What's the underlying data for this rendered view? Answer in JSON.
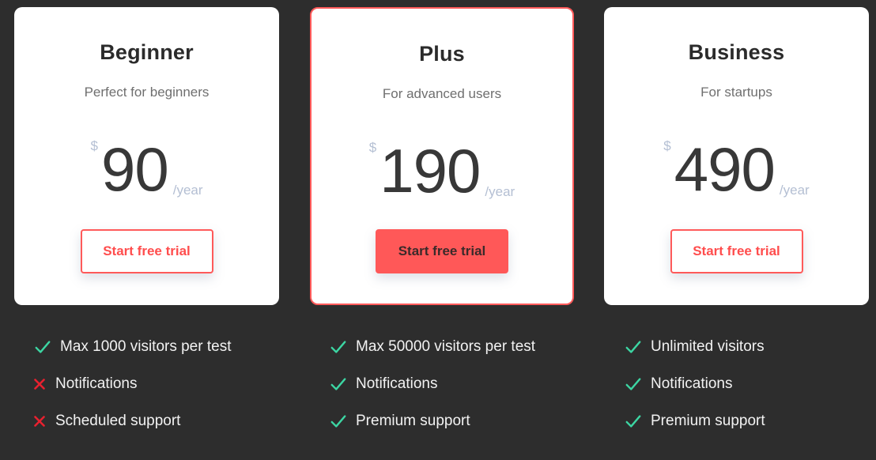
{
  "colors": {
    "background": "#2d2d2d",
    "card": "#ffffff",
    "accent": "#ff5a5a",
    "check": "#3cd6a3",
    "cross": "#e8212f",
    "muted_price": "#b4bfd3"
  },
  "plans": [
    {
      "name": "Beginner",
      "description": "Perfect for beginners",
      "currency": "$",
      "price": "90",
      "period": "/year",
      "cta_label": "Start free trial",
      "featured": false,
      "features": [
        {
          "label": "Max 1000 visitors per test",
          "included": true,
          "icon": "check-icon"
        },
        {
          "label": "Notifications",
          "included": false,
          "icon": "cross-icon"
        },
        {
          "label": "Scheduled support",
          "included": false,
          "icon": "cross-icon"
        }
      ]
    },
    {
      "name": "Plus",
      "description": "For advanced users",
      "currency": "$",
      "price": "190",
      "period": "/year",
      "cta_label": "Start free trial",
      "featured": true,
      "features": [
        {
          "label": "Max 50000 visitors per test",
          "included": true,
          "icon": "check-icon"
        },
        {
          "label": "Notifications",
          "included": true,
          "icon": "check-icon"
        },
        {
          "label": "Premium support",
          "included": true,
          "icon": "check-icon"
        }
      ]
    },
    {
      "name": "Business",
      "description": "For startups",
      "currency": "$",
      "price": "490",
      "period": "/year",
      "cta_label": "Start free trial",
      "featured": false,
      "features": [
        {
          "label": "Unlimited visitors",
          "included": true,
          "icon": "check-icon"
        },
        {
          "label": "Notifications",
          "included": true,
          "icon": "check-icon"
        },
        {
          "label": "Premium support",
          "included": true,
          "icon": "check-icon"
        }
      ]
    }
  ]
}
